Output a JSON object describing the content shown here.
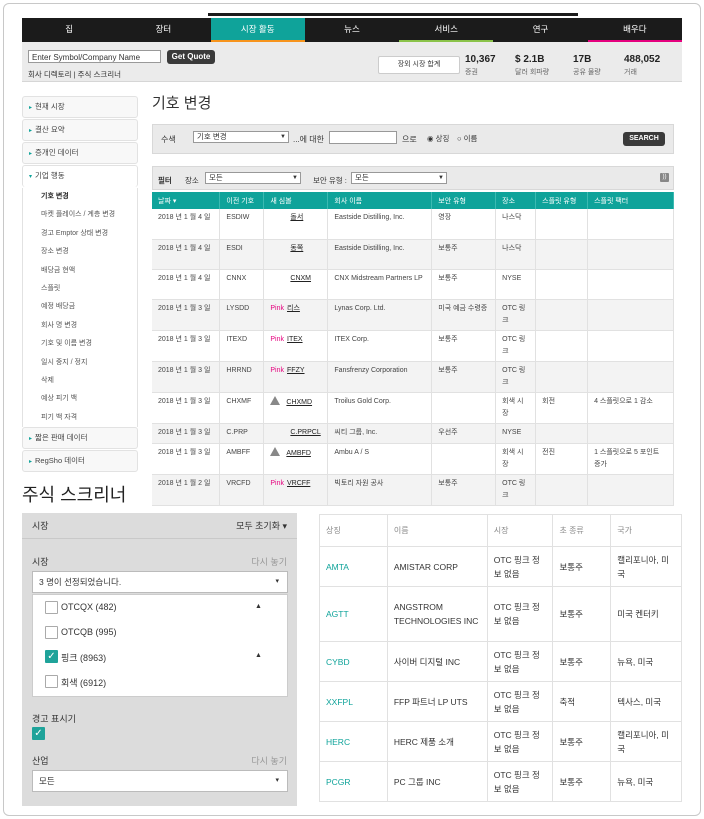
{
  "nav": {
    "items": [
      "집",
      "장터",
      "시장 활동",
      "뉴스",
      "서비스",
      "연구",
      "배우다"
    ],
    "active_index": 2,
    "bar_colors": [
      "#1b1b1b",
      "#1b1b1b",
      "#f7941d",
      "#1b1b1b",
      "#8bc34a",
      "#1b1b1b",
      "#e5007e"
    ]
  },
  "quote": {
    "input_value": "Enter Symbol/Company Name",
    "button": "Get Quote",
    "links": "회사 디렉토리 | 주식 스크리너",
    "market_status": "장외 시장 합계",
    "stats": [
      {
        "value": "10,367",
        "label": "증권"
      },
      {
        "value": "$ 2.1B",
        "label": "달러 회파량"
      },
      {
        "value": "17B",
        "label": "공유 물량"
      },
      {
        "value": "488,052",
        "label": "거래"
      }
    ]
  },
  "left_nav": {
    "sections_top": [
      "현재 시장",
      "결산 요약",
      "증개인 데이터"
    ],
    "open_section": "기업 행동",
    "sub_items": [
      "기호 변경",
      "마켓 플레이스 / 계층 변경",
      "경고 Emptor 상태 변경",
      "장소 변경",
      "배당금 현액",
      "스플릿",
      "예정 배당금",
      "회사 명 변경",
      "기호 및 이름 변경",
      "일시 중지 / 정지",
      "삭제",
      "예상 피기 백",
      "피기 백 자격"
    ],
    "sections_bottom": [
      "짧은 판매 데이터",
      "RegSho 데이터"
    ]
  },
  "symbol_change": {
    "title": "기호 변경",
    "search_label": "수색",
    "search_select": "기호 변경",
    "for_label": "...에 대한",
    "text_label": "으로",
    "radio1": "상징",
    "radio2": "이름",
    "search_button": "SEARCH",
    "filter_label": "필터",
    "venue_label": "장소",
    "venue_value": "모든",
    "sec_type_label": "보안 유형 :",
    "sec_type_value": "모든",
    "rss": "RSS",
    "columns": [
      "날짜 ▾",
      "이전 기호",
      "새 심볼",
      "회사 이름",
      "보안 유형",
      "장소",
      "스플릿 유형",
      "스플릿 팩터"
    ],
    "rows": [
      {
        "date": "2018 년 1 월 4 일",
        "old": "ESDIW",
        "prefix": "",
        "icon": false,
        "new": "돌서",
        "company": "Eastside Distilling, Inc.",
        "type": "영장",
        "venue": "나스닥",
        "split_type": "",
        "split_factor": ""
      },
      {
        "date": "2018 년 1 월 4 일",
        "old": "ESDI",
        "prefix": "",
        "icon": false,
        "new": "동쪽",
        "company": "Eastside Distilling, Inc.",
        "type": "보통주",
        "venue": "나스닥",
        "split_type": "",
        "split_factor": ""
      },
      {
        "date": "2018 년 1 월 4 일",
        "old": "CNNX",
        "prefix": "",
        "icon": false,
        "new": "CNXM",
        "company": "CNX Midstream Partners LP",
        "type": "보통주",
        "venue": "NYSE",
        "split_type": "",
        "split_factor": ""
      },
      {
        "date": "2018 년 1 월 3 일",
        "old": "LYSDD",
        "prefix": "Pink",
        "icon": false,
        "new": "리스",
        "company": "Lynas Corp. Ltd.",
        "type": "미국 예금 수령증",
        "venue": "OTC 링크",
        "split_type": "",
        "split_factor": ""
      },
      {
        "date": "2018 년 1 월 3 일",
        "old": "ITEXD",
        "prefix": "Pink",
        "icon": false,
        "new": "ITEX",
        "company": "ITEX Corp.",
        "type": "보통주",
        "venue": "OTC 링크",
        "split_type": "",
        "split_factor": ""
      },
      {
        "date": "2018 년 1 월 3 일",
        "old": "HRRND",
        "prefix": "Pink",
        "icon": false,
        "new": "FFZY",
        "company": "Fansfrenzy Corporation",
        "type": "보통주",
        "venue": "OTC 링크",
        "split_type": "",
        "split_factor": ""
      },
      {
        "date": "2018 년 1 월 3 일",
        "old": "CHXMF",
        "prefix": "",
        "icon": true,
        "new": "CHXMD",
        "company": "Troilus Gold Corp.",
        "type": "",
        "venue": "회색 시장",
        "split_type": "회전",
        "split_factor": "4 스플릿으로 1 감소"
      },
      {
        "date": "2018 년 1 월 3 일",
        "old": "C.PRP",
        "prefix": "",
        "icon": false,
        "new": "C.PRPCL",
        "company": "씨티 그룹, Inc.",
        "type": "우선주",
        "venue": "NYSE",
        "split_type": "",
        "split_factor": ""
      },
      {
        "date": "2018 년 1 월 3 일",
        "old": "AMBFF",
        "prefix": "",
        "icon": true,
        "new": "AMBFD",
        "company": "Ambu A / S",
        "type": "",
        "venue": "회색 시장",
        "split_type": "전진",
        "split_factor": "1 스플릿으로 5 포인트 증가"
      },
      {
        "date": "2018 년 1 월 2 일",
        "old": "VRCFD",
        "prefix": "Pink",
        "icon": false,
        "new": "VRCFF",
        "company": "빅토리 자원 공사",
        "type": "보통주",
        "venue": "OTC 링크",
        "split_type": "",
        "split_factor": ""
      }
    ]
  },
  "screener": {
    "title": "주식 스크리너",
    "panel_header": "시장",
    "reset_all": "모두 초기화 ▾",
    "market_label": "시장",
    "reset": "다시 놓기",
    "market_dropdown": "3 명이 선정되었습니다.",
    "options": [
      {
        "label": "OTCQX (482)",
        "checked": false
      },
      {
        "label": "OTCQB (995)",
        "checked": false
      },
      {
        "label": "핑크 (8963)",
        "checked": true
      },
      {
        "label": "회색 (6912)",
        "checked": false
      }
    ],
    "caution_label": "경고 표시기",
    "industry_label": "산업",
    "industry_reset": "다시 놓기",
    "industry_value": "모든",
    "columns": [
      "상징",
      "이름",
      "시장",
      "초 종류",
      "국가"
    ],
    "rows": [
      {
        "symbol": "AMTA",
        "name": "AMISTAR CORP",
        "market": "OTC 핑크 정보 없음",
        "type": "보통주",
        "country": "캘리포니아, 미국"
      },
      {
        "symbol": "AGTT",
        "name": "ANGSTROM TECHNOLOGIES INC",
        "market": "OTC 핑크 정보 없음",
        "type": "보통주",
        "country": "미국 켄터키"
      },
      {
        "symbol": "CYBD",
        "name": "사이버 디지털 INC",
        "market": "OTC 핑크 정보 없음",
        "type": "보통주",
        "country": "뉴욕, 미국"
      },
      {
        "symbol": "XXFPL",
        "name": "FFP 파트너 LP UTS",
        "market": "OTC 핑크 정보 없음",
        "type": "축적",
        "country": "텍사스, 미국"
      },
      {
        "symbol": "HERC",
        "name": "HERC 제품 소개",
        "market": "OTC 핑크 정보 없음",
        "type": "보통주",
        "country": "캘리포니아, 미국"
      },
      {
        "symbol": "PCGR",
        "name": "PC 그룹 INC",
        "market": "OTC 핑크 정보 없음",
        "type": "보통주",
        "country": "뉴욕, 미국"
      }
    ]
  }
}
